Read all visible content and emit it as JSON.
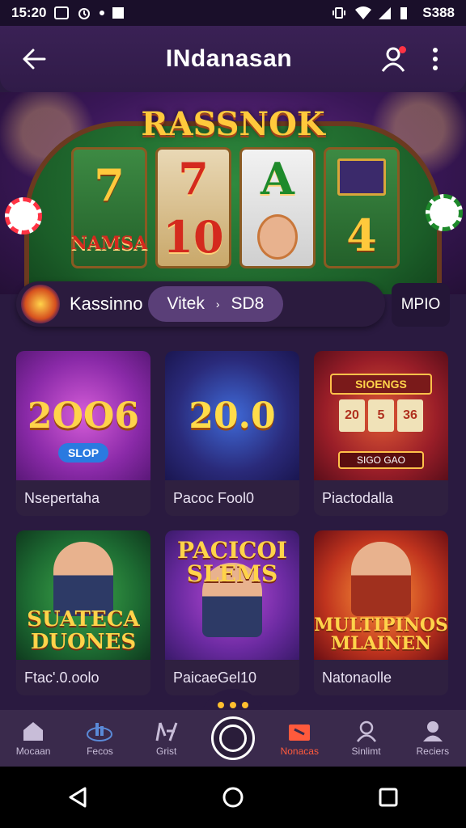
{
  "status_bar": {
    "time": "15:20",
    "battery": "S388"
  },
  "header": {
    "title": "INdanasan"
  },
  "hero": {
    "title": "RASSNOK",
    "reel_symbols": [
      "7",
      "7",
      "A",
      "NAMSA",
      "10",
      "4"
    ]
  },
  "category_bar": {
    "label": "Kassinno",
    "pill_left": "Vitek",
    "pill_right": "SD8",
    "more": "MPIO"
  },
  "games": [
    {
      "name": "Nsepertaha",
      "art": "2OO6",
      "badge": "SLOP"
    },
    {
      "name": "Pacoc Fool0",
      "art": "20.0",
      "badge": ""
    },
    {
      "name": "Piactodalla",
      "art": "SIOENGS",
      "badge": "SIGO GAO"
    },
    {
      "name": "Ftac'.0.oolo",
      "art": "SUATECA DUONES",
      "badge": ""
    },
    {
      "name": "PaicaeGel10",
      "art": "PACICOI SLEMS",
      "badge": ""
    },
    {
      "name": "Natonaolle",
      "art": "MULTIPINOS MLAINEN",
      "badge": ""
    }
  ],
  "bottom_nav": [
    {
      "label": "Mocaan",
      "icon": "home-icon"
    },
    {
      "label": "Fecos",
      "icon": "chart-icon"
    },
    {
      "label": "Grist",
      "icon": "edit-icon"
    },
    {
      "label": "",
      "icon": "spin-icon"
    },
    {
      "label": "Nonacas",
      "icon": "gift-icon",
      "active": true
    },
    {
      "label": "Sinlimt",
      "icon": "person-icon"
    },
    {
      "label": "Reciers",
      "icon": "user-icon"
    }
  ],
  "colors": {
    "accent": "#ff5a3c",
    "gold": "#ffc93c",
    "bg": "#2a1a40"
  }
}
